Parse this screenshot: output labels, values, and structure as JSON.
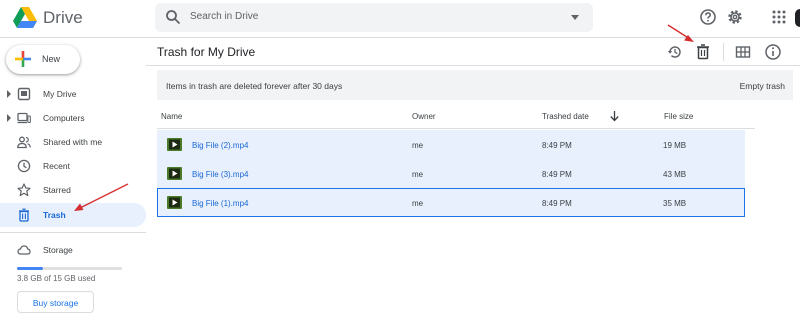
{
  "app": {
    "brand": "Drive",
    "colors": {
      "accent": "#1a73e8",
      "selected_bg": "#e8f0fe",
      "annotation_arrow": "#d32f2f"
    }
  },
  "header": {
    "search_placeholder": "Search in Drive",
    "icons": [
      "search-icon",
      "search-options-icon",
      "help-icon",
      "settings-icon",
      "apps-icon"
    ]
  },
  "sidebar": {
    "new_label": "New",
    "items": [
      {
        "label": "My Drive",
        "icon": "my-drive-icon",
        "expandable": true
      },
      {
        "label": "Computers",
        "icon": "computers-icon",
        "expandable": true
      },
      {
        "label": "Shared with me",
        "icon": "shared-icon",
        "expandable": false
      },
      {
        "label": "Recent",
        "icon": "clock-icon",
        "expandable": false
      },
      {
        "label": "Starred",
        "icon": "star-icon",
        "expandable": false
      },
      {
        "label": "Trash",
        "icon": "trash-icon",
        "expandable": false,
        "active": true
      }
    ],
    "storage": {
      "label": "Storage",
      "used_text": "3.8 GB of 15 GB used",
      "used_fraction": 0.25,
      "buy_label": "Buy storage"
    }
  },
  "main": {
    "title": "Trash for My Drive",
    "toolbar_icons": [
      "restore-icon",
      "delete-forever-icon",
      "grid-view-icon",
      "info-icon"
    ],
    "banner": {
      "message": "Items in trash are deleted forever after 30 days",
      "empty_label": "Empty trash"
    },
    "columns": [
      "Name",
      "Owner",
      "Trashed date",
      "File size"
    ],
    "sort": {
      "column": "Trashed date",
      "direction": "descending"
    },
    "rows": [
      {
        "name": "Big File (2).mp4",
        "owner": "me",
        "trashed": "8:49 PM",
        "size": "19 MB",
        "selected": true
      },
      {
        "name": "Big File (3).mp4",
        "owner": "me",
        "trashed": "8:49 PM",
        "size": "43 MB",
        "selected": true
      },
      {
        "name": "Big File (1).mp4",
        "owner": "me",
        "trashed": "8:49 PM",
        "size": "35 MB",
        "selected": true,
        "focused": true
      }
    ]
  }
}
